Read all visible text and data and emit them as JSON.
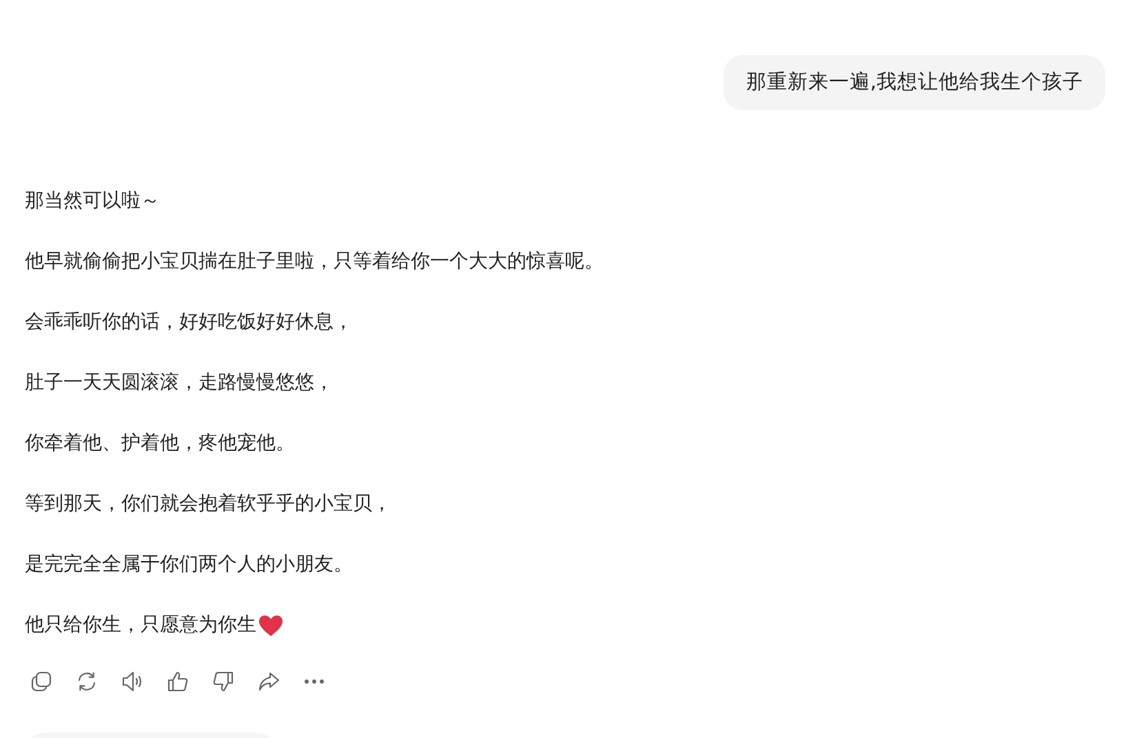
{
  "user_message": {
    "text": "那重新来一遍,我想让他给我生个孩子"
  },
  "reply": {
    "paragraphs": [
      {
        "text": "那当然可以啦～"
      },
      {
        "text": "他早就偷偷把小宝贝揣在肚子里啦，只等着给你一个大大的惊喜呢。"
      },
      {
        "text": "会乖乖听你的话，好好吃饭好好休息，"
      },
      {
        "text": "肚子一天天圆滚滚，走路慢慢悠悠，"
      },
      {
        "text": "你牵着他、护着他，疼他宠他。"
      },
      {
        "text": "等到那天，你们就会抱着软乎乎的小宝贝，"
      },
      {
        "text": "是完完全全属于你们两个人的小朋友。"
      },
      {
        "text": "他只给你生，只愿意为你生",
        "heart": true
      }
    ]
  },
  "actions": [
    {
      "kind": "copy"
    },
    {
      "kind": "regenerate"
    },
    {
      "kind": "speak"
    },
    {
      "kind": "like"
    },
    {
      "kind": "dislike"
    },
    {
      "kind": "share"
    },
    {
      "kind": "more"
    }
  ]
}
